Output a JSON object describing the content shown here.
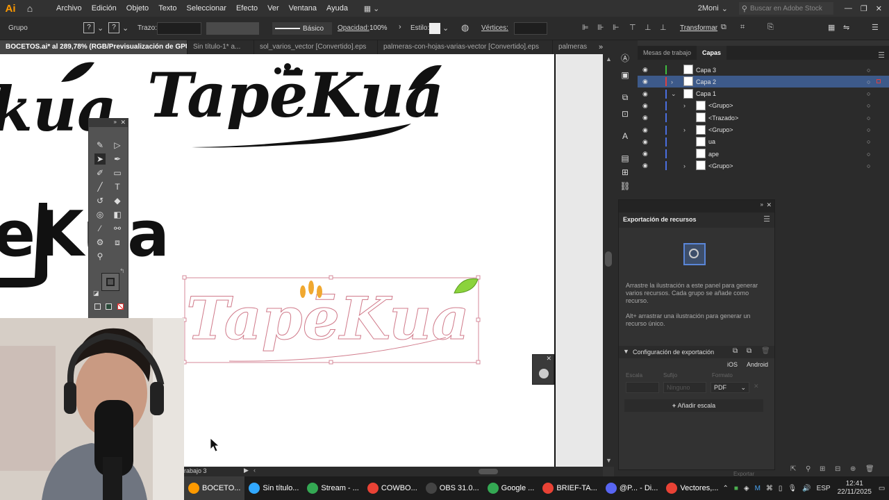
{
  "menubar": {
    "items": [
      "Archivo",
      "Edición",
      "Objeto",
      "Texto",
      "Seleccionar",
      "Efecto",
      "Ver",
      "Ventana",
      "Ayuda"
    ],
    "workspace": "2Moni",
    "search_placeholder": "Buscar en Adobe Stock"
  },
  "control": {
    "selection": "Grupo",
    "stroke_label": "Trazo:",
    "stroke_style": "Básico",
    "opacity_label": "Opacidad:",
    "opacity_value": "100%",
    "style_label": "Estilo:",
    "vertices_label": "Vértices:",
    "transform": "Transformar"
  },
  "tabs": [
    "BOCETOS.ai* al 289,78% (RGB/Previsualización de GPU)",
    "Sin título-1* a...",
    "sol_varios_vector [Convertido].eps",
    "palmeras-con-hojas-varias-vector [Convertido].eps",
    "palmeras"
  ],
  "canvas": {
    "logo_text": "TapeKua",
    "artboard_label": "rabajo 3"
  },
  "layers": {
    "tabs": [
      "Mesas de trabajo",
      "Capas"
    ],
    "rows": [
      {
        "name": "Capa 3",
        "color": "#3fbf3f"
      },
      {
        "name": "Capa 2",
        "color": "#e04040"
      },
      {
        "name": "Capa 1",
        "color": "#4a6fe0"
      },
      {
        "name": "<Grupo>",
        "color": "#4a6fe0"
      },
      {
        "name": "<Trazado>",
        "color": "#4a6fe0"
      },
      {
        "name": "<Grupo>",
        "color": "#4a6fe0"
      },
      {
        "name": "ua",
        "color": "#4a6fe0"
      },
      {
        "name": "ape",
        "color": "#4a6fe0"
      },
      {
        "name": "<Grupo>",
        "color": "#4a6fe0"
      }
    ]
  },
  "export": {
    "title": "Exportación de recursos",
    "desc1": "Arrastre la ilustración a este panel para generar varios recursos. Cada grupo se añade como recurso.",
    "desc2": "Alt+ arrastrar una ilustración para generar un recurso único.",
    "config": "Configuración de exportación",
    "ios": "iOS",
    "android": "Android",
    "scale_label": "Escala",
    "suffix_label": "Sufijo",
    "format_label": "Formato",
    "suffix_placeholder": "Ninguno",
    "format": "PDF",
    "add_scale": "Añadir escala",
    "export_btn": "Exportar"
  },
  "taskbar": {
    "items": [
      {
        "label": "BOCETO...",
        "color": "#ff9a00"
      },
      {
        "label": "Sin título...",
        "color": "#31a8ff"
      },
      {
        "label": "Stream - ...",
        "color": "#34a853"
      },
      {
        "label": "COWBO...",
        "color": "#e94235"
      },
      {
        "label": "OBS 31.0...",
        "color": "#444"
      },
      {
        "label": "Google ...",
        "color": "#34a853"
      },
      {
        "label": "BRIEF-TA...",
        "color": "#e94235"
      },
      {
        "label": "@P... - Di...",
        "color": "#5865f2"
      },
      {
        "label": "Vectores,...",
        "color": "#e94235"
      }
    ],
    "lang": "ESP",
    "time": "12:41",
    "date": "22/11/2025"
  },
  "colors": {
    "accent": "#ff9a00",
    "selection": "#4a6fe0",
    "leaf": "#8bd33c",
    "paw": "#f0a830"
  }
}
